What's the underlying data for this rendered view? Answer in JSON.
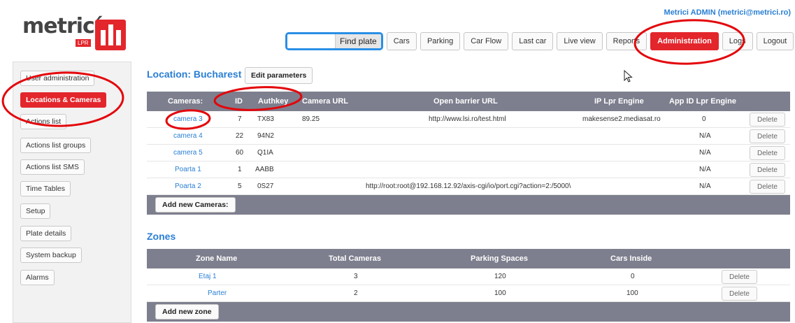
{
  "brand": {
    "logo_text": "metricí",
    "logo_sub": "LPR"
  },
  "user": {
    "label": "Metrici ADMIN (metrici@metrici.ro)"
  },
  "search": {
    "value": "",
    "placeholder": "",
    "button_label": "Find plate"
  },
  "nav": [
    "Cars",
    "Parking",
    "Car Flow",
    "Last car",
    "Live view",
    "Reports",
    "Administration",
    "Logs",
    "Logout"
  ],
  "nav_active": "Administration",
  "sidebar": {
    "items": [
      {
        "label": "User administration"
      },
      {
        "label": "Locations & Cameras",
        "active": true
      },
      {
        "label": "Actions list"
      },
      {
        "label": "Actions list groups"
      },
      {
        "label": "Actions list SMS"
      },
      {
        "label": "Time Tables"
      },
      {
        "label": "Setup"
      },
      {
        "label": "Plate details"
      },
      {
        "label": "System backup"
      },
      {
        "label": "Alarms"
      }
    ]
  },
  "location": {
    "title": "Location: Bucharest",
    "edit_label": "Edit parameters"
  },
  "cameras": {
    "headers": [
      "Cameras:",
      "ID",
      "Authkey",
      "Camera URL",
      "Open barrier URL",
      "IP Lpr Engine",
      "App ID Lpr Engine"
    ],
    "rows": [
      {
        "name": "camera 3",
        "id": "7",
        "authkey": "TX83",
        "camera_url": "89.25",
        "barrier_url": "http://www.lsi.ro/test.html",
        "ip_engine": "makesense2.mediasat.ro",
        "app_id": "0",
        "delete": "Delete"
      },
      {
        "name": "camera 4",
        "id": "22",
        "authkey": "94N2",
        "camera_url": "",
        "barrier_url": "",
        "ip_engine": "",
        "app_id": "N/A",
        "delete": "Delete"
      },
      {
        "name": "camera 5",
        "id": "60",
        "authkey": "Q1IA",
        "camera_url": "",
        "barrier_url": "",
        "ip_engine": "",
        "app_id": "N/A",
        "delete": "Delete"
      },
      {
        "name": "Poarta 1",
        "id": "1",
        "authkey": "AABB",
        "camera_url": "",
        "barrier_url": "",
        "ip_engine": "",
        "app_id": "N/A",
        "delete": "Delete"
      },
      {
        "name": "Poarta 2",
        "id": "5",
        "authkey": "0S27",
        "camera_url": "",
        "barrier_url": "http://root:root@192.168.12.92/axis-cgi/io/port.cgi?action=2:/5000\\",
        "ip_engine": "",
        "app_id": "N/A",
        "delete": "Delete"
      }
    ],
    "add_label": "Add new Cameras:"
  },
  "zones": {
    "title": "Zones",
    "headers": [
      "Zone Name",
      "Total Cameras",
      "Parking Spaces",
      "Cars Inside"
    ],
    "rows": [
      {
        "name": "Etaj 1",
        "total_cameras": "3",
        "parking_spaces": "120",
        "cars_inside": "0",
        "delete": "Delete"
      },
      {
        "name": "Parter",
        "total_cameras": "2",
        "parking_spaces": "100",
        "cars_inside": "100",
        "delete": "Delete"
      }
    ],
    "add_label": "Add new zone"
  },
  "colors": {
    "accent": "#e3262c",
    "link": "#2a7fd4",
    "table_header": "#7d7f8e"
  }
}
